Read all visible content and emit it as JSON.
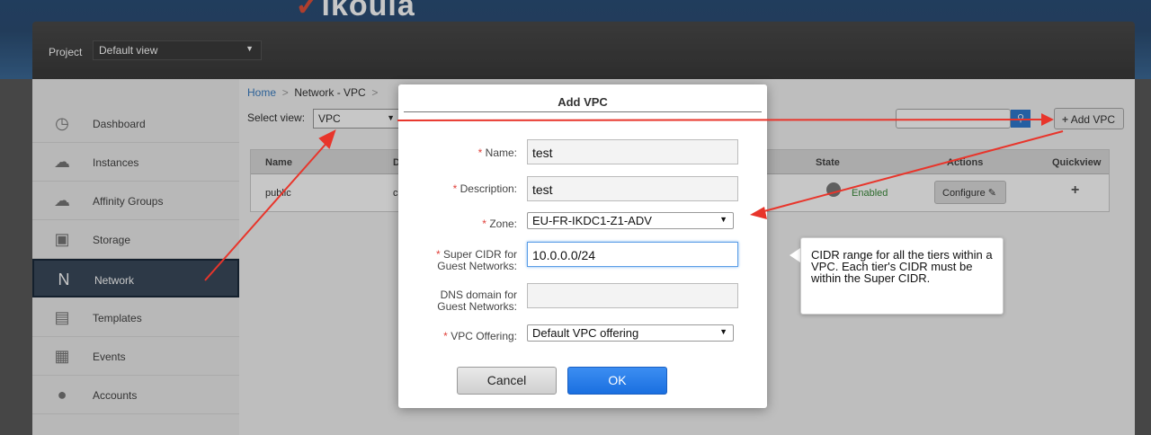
{
  "brand": {
    "name": "ikoula"
  },
  "project": {
    "label": "Project",
    "selected": "Default view"
  },
  "sidebar": {
    "items": [
      {
        "label": "Dashboard",
        "icon": "dashboard-icon"
      },
      {
        "label": "Instances",
        "icon": "cloud-icon"
      },
      {
        "label": "Affinity Groups",
        "icon": "affinity-cloud-icon"
      },
      {
        "label": "Storage",
        "icon": "storage-icon"
      },
      {
        "label": "Network",
        "icon": "network-icon",
        "active": true
      },
      {
        "label": "Templates",
        "icon": "templates-icon"
      },
      {
        "label": "Events",
        "icon": "calendar-icon"
      },
      {
        "label": "Accounts",
        "icon": "user-icon"
      }
    ]
  },
  "breadcrumb": {
    "home": "Home",
    "sep": ">",
    "current": "Network - VPC",
    "sep2": ">"
  },
  "view": {
    "label": "Select view:",
    "selected": "VPC"
  },
  "toolbar": {
    "add_vpc_label": "Add VPC"
  },
  "table": {
    "headers": {
      "name": "Name",
      "d": "D",
      "state": "State",
      "actions": "Actions",
      "quickview": "Quickview"
    },
    "rows": [
      {
        "name": "public",
        "d": "c",
        "state": "Enabled",
        "action": "Configure"
      }
    ]
  },
  "dialog": {
    "title": "Add VPC",
    "fields": {
      "name": {
        "label": "Name:",
        "value": "test"
      },
      "description": {
        "label": "Description:",
        "value": "test"
      },
      "zone": {
        "label": "Zone:",
        "value": "EU-FR-IKDC1-Z1-ADV"
      },
      "cidr": {
        "label_line1": "Super CIDR for",
        "label_line2": "Guest Networks:",
        "value": "10.0.0.0/24"
      },
      "dns": {
        "label_line1": "DNS domain for",
        "label_line2": "Guest Networks:",
        "value": ""
      },
      "offering": {
        "label": "VPC Offering:",
        "value": "Default VPC offering"
      }
    },
    "required_mark": "*",
    "cancel_label": "Cancel",
    "ok_label": "OK"
  },
  "tooltip": {
    "text": "CIDR range for all the tiers within a VPC. Each tier's CIDR must be within the Super CIDR."
  },
  "colors": {
    "annotation_arrow": "#e8352b",
    "accent": "#1a6fe0"
  }
}
